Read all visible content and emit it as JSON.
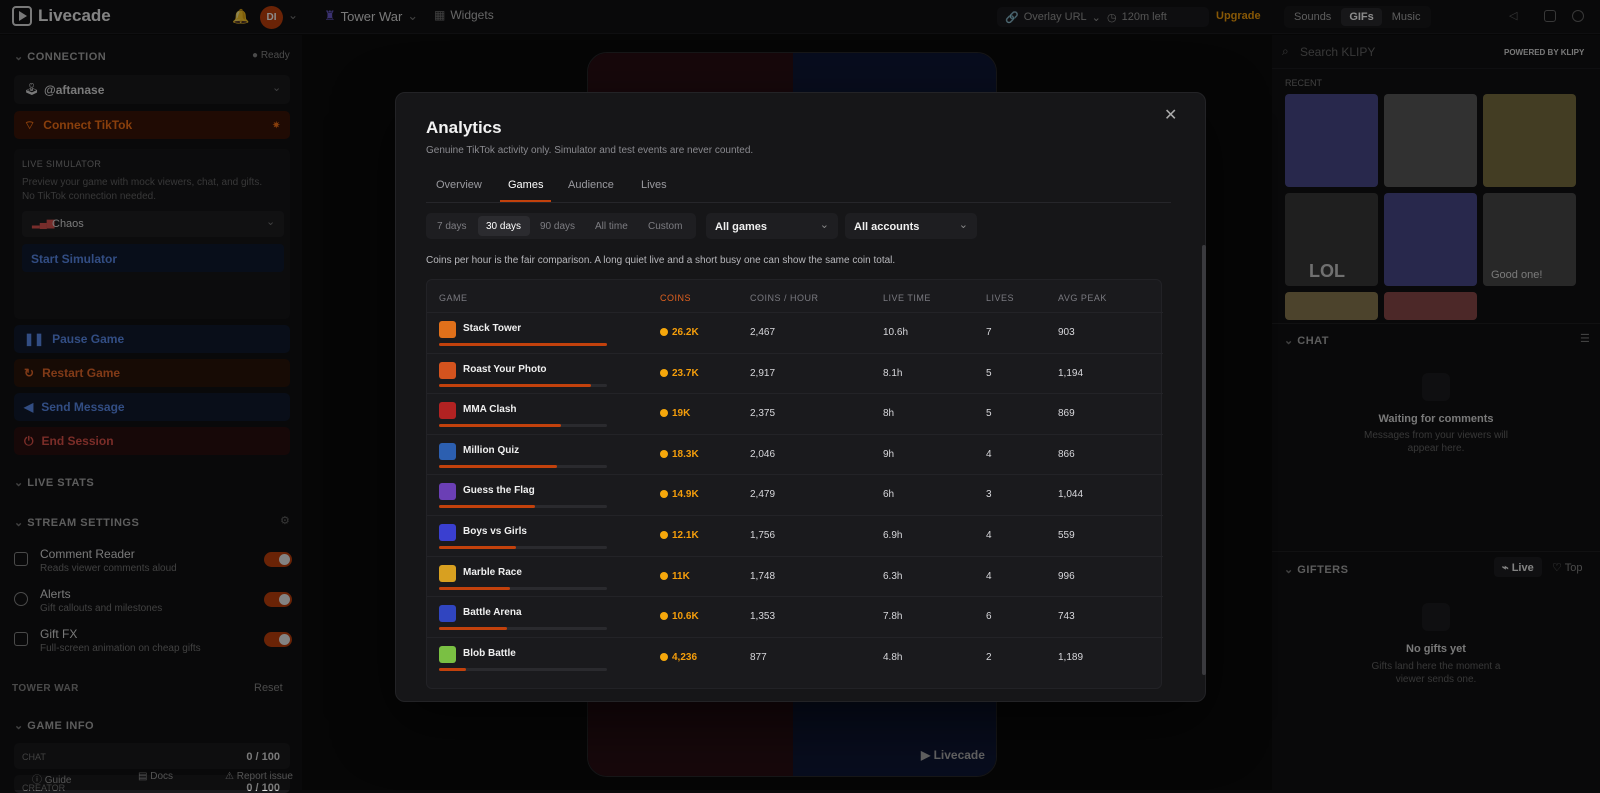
{
  "app": {
    "name": "Livecade"
  },
  "topbar": {
    "avatar_initials": "DI",
    "game": "Tower War",
    "widgets": "Widgets",
    "overlay_url": "Overlay URL",
    "time_left": "120m left",
    "upgrade": "Upgrade",
    "tabs": [
      "Sounds",
      "GIFs",
      "Music"
    ],
    "active_tab": "GIFs"
  },
  "sidebar": {
    "connection": {
      "title": "CONNECTION",
      "status": "Ready",
      "account": "@aftanase",
      "connect_label": "Connect TikTok"
    },
    "simulator": {
      "title": "LIVE SIMULATOR",
      "desc_1": "Preview your game with mock viewers, chat, and gifts.",
      "desc_2": "No TikTok connection needed.",
      "mode": "Chaos",
      "start": "Start Simulator"
    },
    "actions": {
      "pause": "Pause Game",
      "restart": "Restart Game",
      "send": "Send Message",
      "end": "End Session"
    },
    "live_stats": "LIVE STATS",
    "stream_settings": {
      "title": "STREAM SETTINGS",
      "items": [
        {
          "title": "Comment Reader",
          "sub": "Reads viewer comments aloud"
        },
        {
          "title": "Alerts",
          "sub": "Gift callouts and milestones"
        },
        {
          "title": "Gift FX",
          "sub": "Full-screen animation on cheap gifts"
        }
      ]
    },
    "tower_war": {
      "title": "TOWER WAR",
      "reset": "Reset"
    },
    "game_info": {
      "title": "GAME INFO",
      "chat_label": "CHAT",
      "chat_value": "0 / 100",
      "creator_label": "CREATOR",
      "creator_value": "0 / 100"
    },
    "footer": {
      "guide": "Guide",
      "docs": "Docs",
      "report": "Report issue"
    }
  },
  "phone": {
    "watermark": "Livecade"
  },
  "right": {
    "search_placeholder": "Search KLIPY",
    "powered": "POWERED BY KLIPY",
    "recent": "RECENT",
    "gif_captions": [
      "",
      "",
      "",
      "LOL",
      "",
      "Good one!"
    ],
    "chat": {
      "title": "CHAT",
      "empty_title": "Waiting for comments",
      "empty_sub_1": "Messages from your viewers will",
      "empty_sub_2": "appear here."
    },
    "gifters": {
      "title": "GIFTERS",
      "live": "Live",
      "top": "Top",
      "empty_title": "No gifts yet",
      "empty_sub_1": "Gifts land here the moment a",
      "empty_sub_2": "viewer sends one."
    }
  },
  "modal": {
    "title": "Analytics",
    "subtitle": "Genuine TikTok activity only. Simulator and test events are never counted.",
    "tabs": [
      "Overview",
      "Games",
      "Audience",
      "Lives"
    ],
    "active_tab": "Games",
    "ranges": [
      "7 days",
      "30 days",
      "90 days",
      "All time",
      "Custom"
    ],
    "active_range": "30 days",
    "filter_games": "All games",
    "filter_accounts": "All accounts",
    "note": "Coins per hour is the fair comparison. A long quiet live and a short busy one can show the same coin total.",
    "columns": [
      "GAME",
      "COINS",
      "COINS / HOUR",
      "LIVE TIME",
      "LIVES",
      "AVG PEAK"
    ],
    "rows": [
      {
        "game": "Stack Tower",
        "coins": "26.2K",
        "cph": "2,467",
        "time": "10.6h",
        "lives": "7",
        "peak": "903",
        "share": 1.0,
        "color": "#e0701a"
      },
      {
        "game": "Roast Your Photo",
        "coins": "23.7K",
        "cph": "2,917",
        "time": "8.1h",
        "lives": "5",
        "peak": "1,194",
        "share": 0.905,
        "color": "#d4531e"
      },
      {
        "game": "MMA Clash",
        "coins": "19K",
        "cph": "2,375",
        "time": "8h",
        "lives": "5",
        "peak": "869",
        "share": 0.725,
        "color": "#b22222"
      },
      {
        "game": "Million Quiz",
        "coins": "18.3K",
        "cph": "2,046",
        "time": "9h",
        "lives": "4",
        "peak": "866",
        "share": 0.7,
        "color": "#2c5fb0"
      },
      {
        "game": "Guess the Flag",
        "coins": "14.9K",
        "cph": "2,479",
        "time": "6h",
        "lives": "3",
        "peak": "1,044",
        "share": 0.57,
        "color": "#6b3fb5"
      },
      {
        "game": "Boys vs Girls",
        "coins": "12.1K",
        "cph": "1,756",
        "time": "6.9h",
        "lives": "4",
        "peak": "559",
        "share": 0.46,
        "color": "#3a3fd0"
      },
      {
        "game": "Marble Race",
        "coins": "11K",
        "cph": "1,748",
        "time": "6.3h",
        "lives": "4",
        "peak": "996",
        "share": 0.42,
        "color": "#d8a020"
      },
      {
        "game": "Battle Arena",
        "coins": "10.6K",
        "cph": "1,353",
        "time": "7.8h",
        "lives": "6",
        "peak": "743",
        "share": 0.405,
        "color": "#3045c0"
      },
      {
        "game": "Blob Battle",
        "coins": "4,236",
        "cph": "877",
        "time": "4.8h",
        "lives": "2",
        "peak": "1,189",
        "share": 0.16,
        "color": "#7ac043"
      }
    ]
  }
}
